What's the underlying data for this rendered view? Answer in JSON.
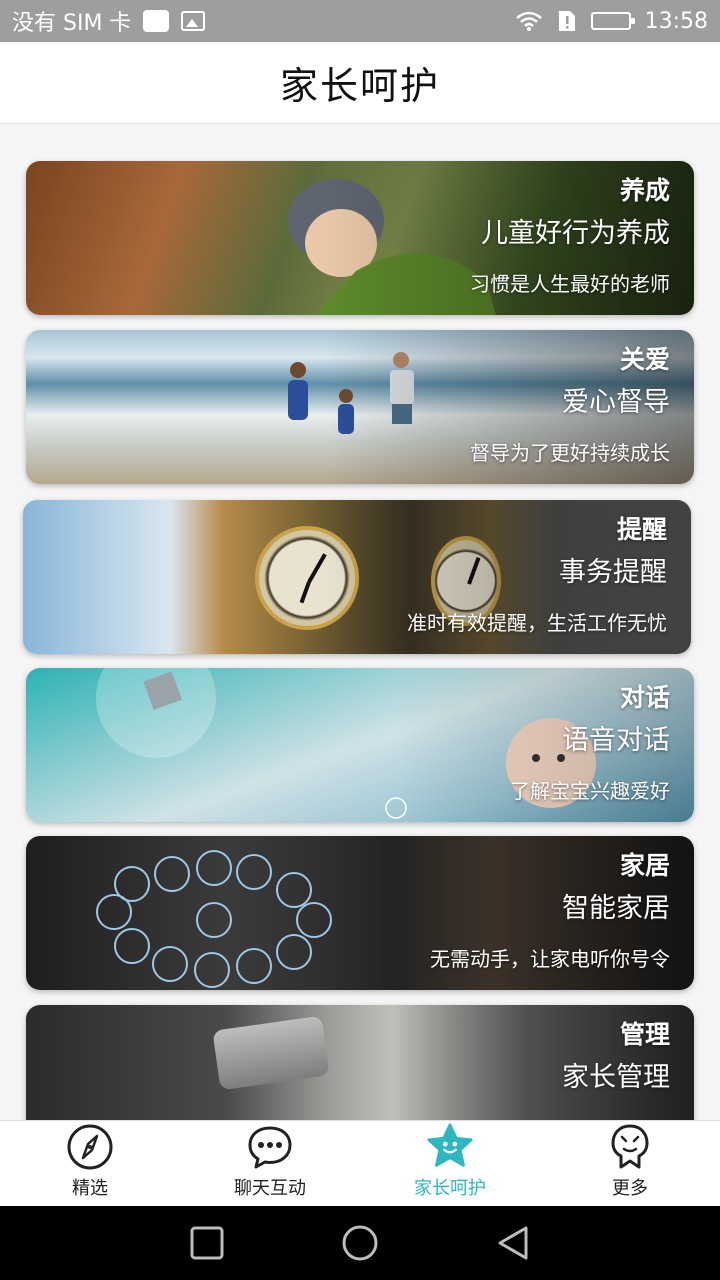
{
  "status_bar": {
    "carrier": "没有 SIM 卡",
    "time": "13:58"
  },
  "header": {
    "title": "家长呵护"
  },
  "cards": [
    {
      "tag": "养成",
      "title": "儿童好行为养成",
      "subtitle": "习惯是人生最好的老师"
    },
    {
      "tag": "关爱",
      "title": "爱心督导",
      "subtitle": "督导为了更好持续成长"
    },
    {
      "tag": "提醒",
      "title": "事务提醒",
      "subtitle": "准时有效提醒，生活工作无忧"
    },
    {
      "tag": "对话",
      "title": "语音对话",
      "subtitle": "了解宝宝兴趣爱好"
    },
    {
      "tag": "家居",
      "title": "智能家居",
      "subtitle": "无需动手，让家电听你号令"
    },
    {
      "tag": "管理",
      "title": "家长管理",
      "subtitle": ""
    }
  ],
  "tabbar": {
    "items": [
      {
        "label": "精选",
        "icon": "compass-icon"
      },
      {
        "label": "聊天互动",
        "icon": "chat-bubble-icon"
      },
      {
        "label": "家长呵护",
        "icon": "star-icon"
      },
      {
        "label": "更多",
        "icon": "more-face-icon"
      }
    ],
    "active_index": 2,
    "accent_color": "#2bb8c0"
  },
  "colors": {
    "status_bar": "#9e9e9e",
    "background": "#f5f5f5",
    "nav_bar": "#000000"
  }
}
